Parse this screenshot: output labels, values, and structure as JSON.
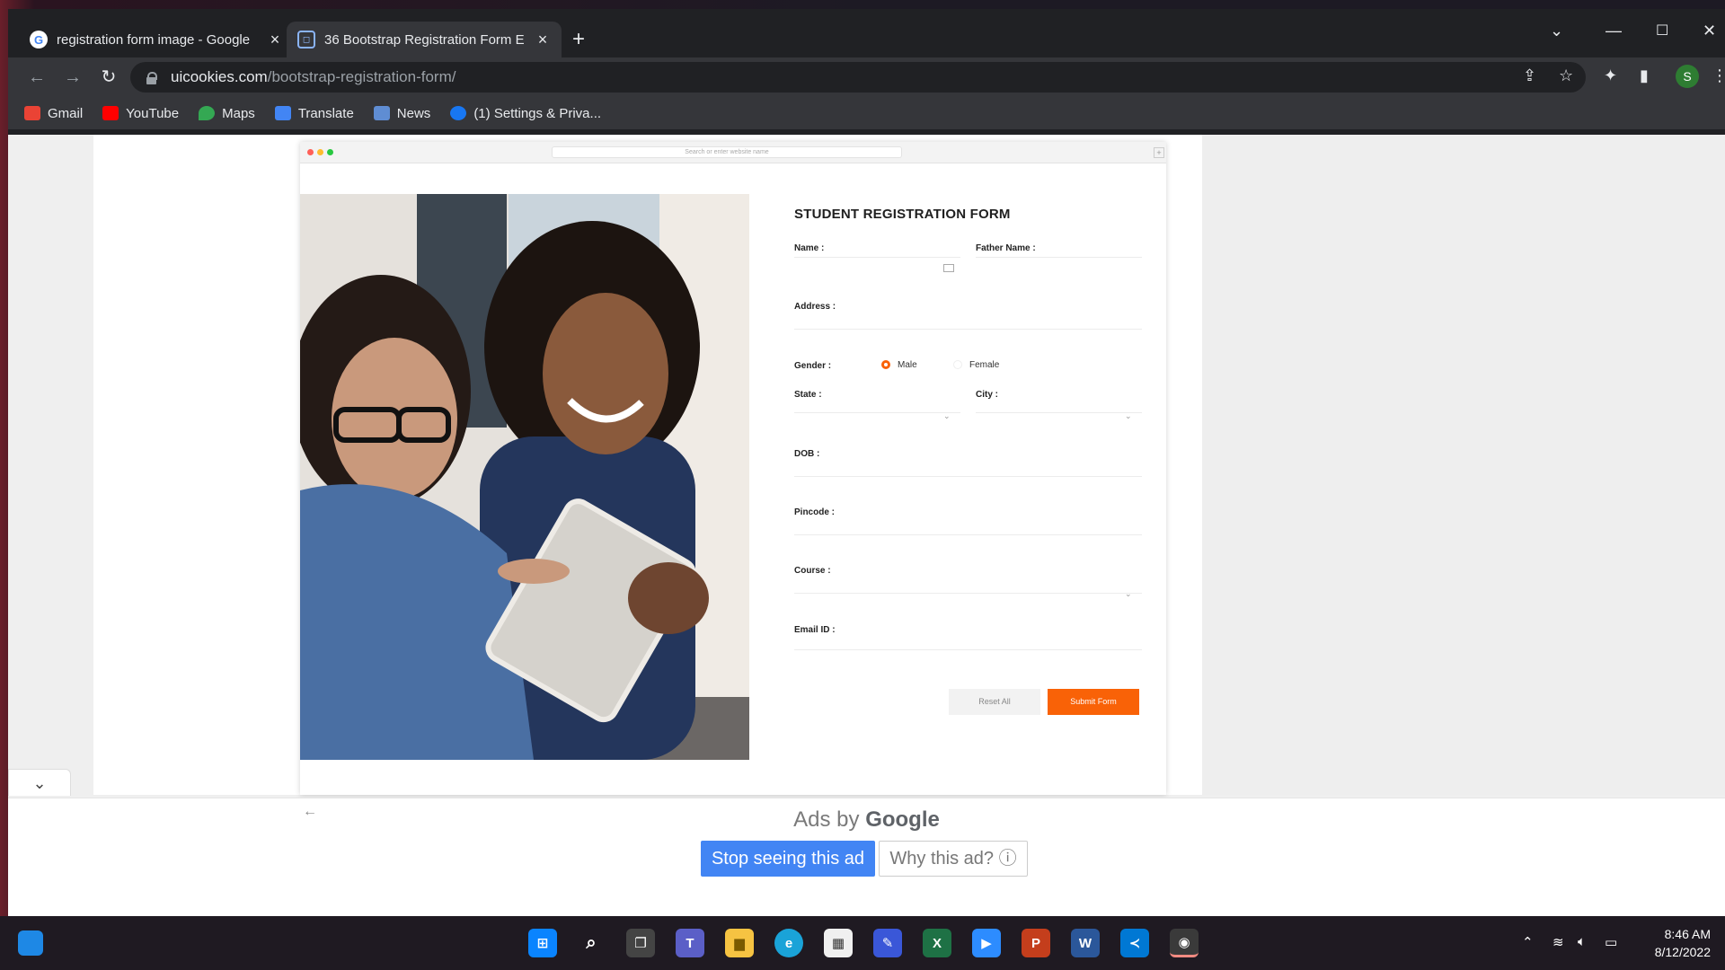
{
  "tabs": [
    {
      "title": "registration form image - Google",
      "favicon": "google-icon",
      "active": false
    },
    {
      "title": "36 Bootstrap Registration Form E",
      "favicon": "uicookies-icon",
      "active": true
    }
  ],
  "address": {
    "host": "uicookies.com",
    "path": "/bootstrap-registration-form/"
  },
  "profile_initial": "S",
  "bookmarks": [
    {
      "label": "Gmail",
      "icon": "gmail-icon",
      "color": "#ea4335"
    },
    {
      "label": "YouTube",
      "icon": "youtube-icon",
      "color": "#ff0000"
    },
    {
      "label": "Maps",
      "icon": "maps-icon",
      "color": "#34a853"
    },
    {
      "label": "Translate",
      "icon": "translate-icon",
      "color": "#4285f4"
    },
    {
      "label": "News",
      "icon": "news-icon",
      "color": "#5f8dd3"
    },
    {
      "label": "(1) Settings & Priva...",
      "icon": "facebook-icon",
      "color": "#1877f2"
    }
  ],
  "mock_browser": {
    "search_placeholder": "Search or enter website name"
  },
  "form": {
    "title": "STUDENT REGISTRATION FORM",
    "name_label": "Name :",
    "father_label": "Father Name :",
    "address_label": "Address :",
    "gender_label": "Gender :",
    "gender_options": [
      "Male",
      "Female"
    ],
    "gender_selected": "Male",
    "state_label": "State :",
    "city_label": "City :",
    "dob_label": "DOB :",
    "pincode_label": "Pincode :",
    "course_label": "Course :",
    "email_label": "Email ID :",
    "reset_label": "Reset All",
    "submit_label": "Submit Form",
    "accent_color": "#f96207"
  },
  "ad": {
    "ads_by": "Ads by",
    "brand": "Google",
    "stop_label": "Stop seeing this ad",
    "why_label": "Why this ad? ⓘ"
  },
  "taskbar": {
    "apps": [
      "start",
      "search",
      "task-view",
      "teams",
      "file-explorer",
      "edge",
      "store",
      "notepad",
      "excel",
      "zoom",
      "powerpoint",
      "word",
      "vscode",
      "chrome"
    ],
    "time": "8:46 AM",
    "date": "8/12/2022"
  }
}
